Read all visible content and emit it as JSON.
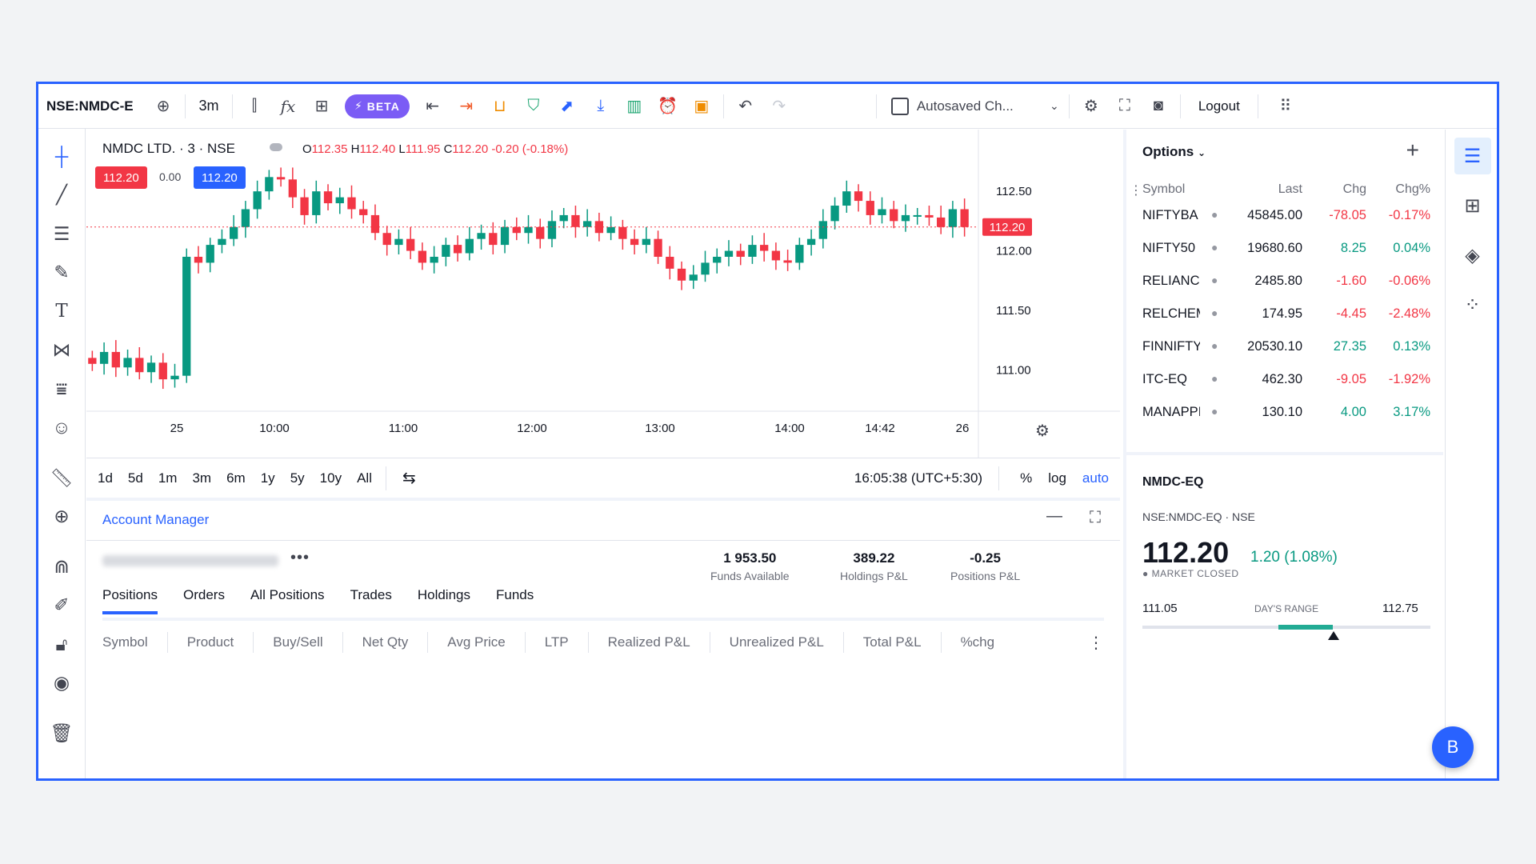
{
  "toolbar": {
    "symbol": "NSE:NMDC-E",
    "interval": "3m",
    "beta_label": "BETA",
    "autosave_label": "Autosaved Ch...",
    "logout_label": "Logout",
    "icons": [
      "add-symbol-icon",
      "candle-type-icon",
      "indicators-icon",
      "templates-icon",
      "import-icon",
      "export-icon",
      "basket-icon",
      "shield-icon",
      "trend-icon",
      "download-icon",
      "bar-chart-icon",
      "alert-icon",
      "money-icon",
      "undo-icon",
      "redo-icon",
      "settings-icon",
      "fullscreen-icon",
      "snapshot-icon",
      "apps-grid-icon"
    ]
  },
  "chart": {
    "title": "NMDC LTD. · 3 · NSE",
    "ohlc": {
      "o_label": "O",
      "o": "112.35",
      "h_label": "H",
      "h": "112.40",
      "l_label": "L",
      "l": "111.95",
      "c_label": "C",
      "c": "112.20",
      "change": "-0.20 (-0.18%)"
    },
    "sell_price": "112.20",
    "spread": "0.00",
    "buy_price": "112.20",
    "last_price_label": "112.20",
    "y_ticks": [
      "112.50",
      "112.00",
      "111.50",
      "111.00"
    ],
    "x_ticks": [
      "25",
      "10:00",
      "11:00",
      "12:00",
      "13:00",
      "14:00",
      "14:42",
      "26"
    ]
  },
  "chart_data": {
    "type": "candlestick",
    "ylim": [
      110.8,
      112.75
    ],
    "y_ticks": [
      112.5,
      112.0,
      111.5,
      111.0
    ],
    "x_ticks": [
      "25",
      "10:00",
      "11:00",
      "12:00",
      "13:00",
      "14:00",
      "14:42",
      "26"
    ],
    "last_price": 112.2,
    "close": [
      111.05,
      111.15,
      111.02,
      111.1,
      110.98,
      111.06,
      110.92,
      110.95,
      111.95,
      111.9,
      112.05,
      112.1,
      112.2,
      112.35,
      112.5,
      112.62,
      112.6,
      112.45,
      112.3,
      112.5,
      112.4,
      112.45,
      112.35,
      112.3,
      112.15,
      112.05,
      112.1,
      112.0,
      111.9,
      111.95,
      112.05,
      111.98,
      112.1,
      112.15,
      112.05,
      112.2,
      112.15,
      112.2,
      112.1,
      112.25,
      112.3,
      112.2,
      112.25,
      112.15,
      112.2,
      112.1,
      112.05,
      112.1,
      111.95,
      111.85,
      111.75,
      111.8,
      111.9,
      111.95,
      112.0,
      111.95,
      112.05,
      112.0,
      111.92,
      111.9,
      112.05,
      112.1,
      112.25,
      112.38,
      112.5,
      112.42,
      112.3,
      112.35,
      112.25,
      112.3,
      112.3,
      112.28,
      112.2,
      112.35,
      112.2
    ]
  },
  "range_bar": {
    "ranges": [
      "1d",
      "5d",
      "1m",
      "3m",
      "6m",
      "1y",
      "5y",
      "10y",
      "All"
    ],
    "time": "16:05:38 (UTC+5:30)",
    "pct": "%",
    "log": "log",
    "auto": "auto"
  },
  "account": {
    "title": "Account Manager",
    "funds_value": "1 953.50",
    "funds_label": "Funds Available",
    "holdings_value": "389.22",
    "holdings_label": "Holdings P&L",
    "positions_value": "-0.25",
    "positions_label": "Positions P&L",
    "tabs": [
      "Positions",
      "Orders",
      "All Positions",
      "Trades",
      "Holdings",
      "Funds"
    ],
    "columns": [
      "Symbol",
      "Product",
      "Buy/Sell",
      "Net Qty",
      "Avg Price",
      "LTP",
      "Realized P&L",
      "Unrealized P&L",
      "Total P&L",
      "%chg"
    ]
  },
  "watchlist": {
    "title": "Options",
    "headers": {
      "symbol": "Symbol",
      "last": "Last",
      "chg": "Chg",
      "pct": "Chg%"
    },
    "rows": [
      {
        "symbol": "NIFTYBA",
        "last": "45845.00",
        "chg": "-78.05",
        "pct": "-0.17%",
        "dir": "down"
      },
      {
        "symbol": "NIFTY50",
        "last": "19680.60",
        "chg": "8.25",
        "pct": "0.04%",
        "dir": "up"
      },
      {
        "symbol": "RELIANC",
        "last": "2485.80",
        "chg": "-1.60",
        "pct": "-0.06%",
        "dir": "down"
      },
      {
        "symbol": "RELCHEM",
        "last": "174.95",
        "chg": "-4.45",
        "pct": "-2.48%",
        "dir": "down"
      },
      {
        "symbol": "FINNIFTY",
        "last": "20530.10",
        "chg": "27.35",
        "pct": "0.13%",
        "dir": "up"
      },
      {
        "symbol": "ITC-EQ",
        "last": "462.30",
        "chg": "-9.05",
        "pct": "-1.92%",
        "dir": "down"
      },
      {
        "symbol": "MANAPPI",
        "last": "130.10",
        "chg": "4.00",
        "pct": "3.17%",
        "dir": "up"
      }
    ]
  },
  "details": {
    "symbol": "NMDC-EQ",
    "exchange_line": "NSE:NMDC-EQ · NSE",
    "price": "112.20",
    "change": "1.20 (1.08%)",
    "status": "MARKET CLOSED",
    "low": "111.05",
    "range_label": "DAY'S RANGE",
    "high": "112.75",
    "range_fill": 0.65
  },
  "bubble": "B",
  "colors": {
    "up": "#089981",
    "down": "#f23645",
    "accent": "#2962ff"
  }
}
